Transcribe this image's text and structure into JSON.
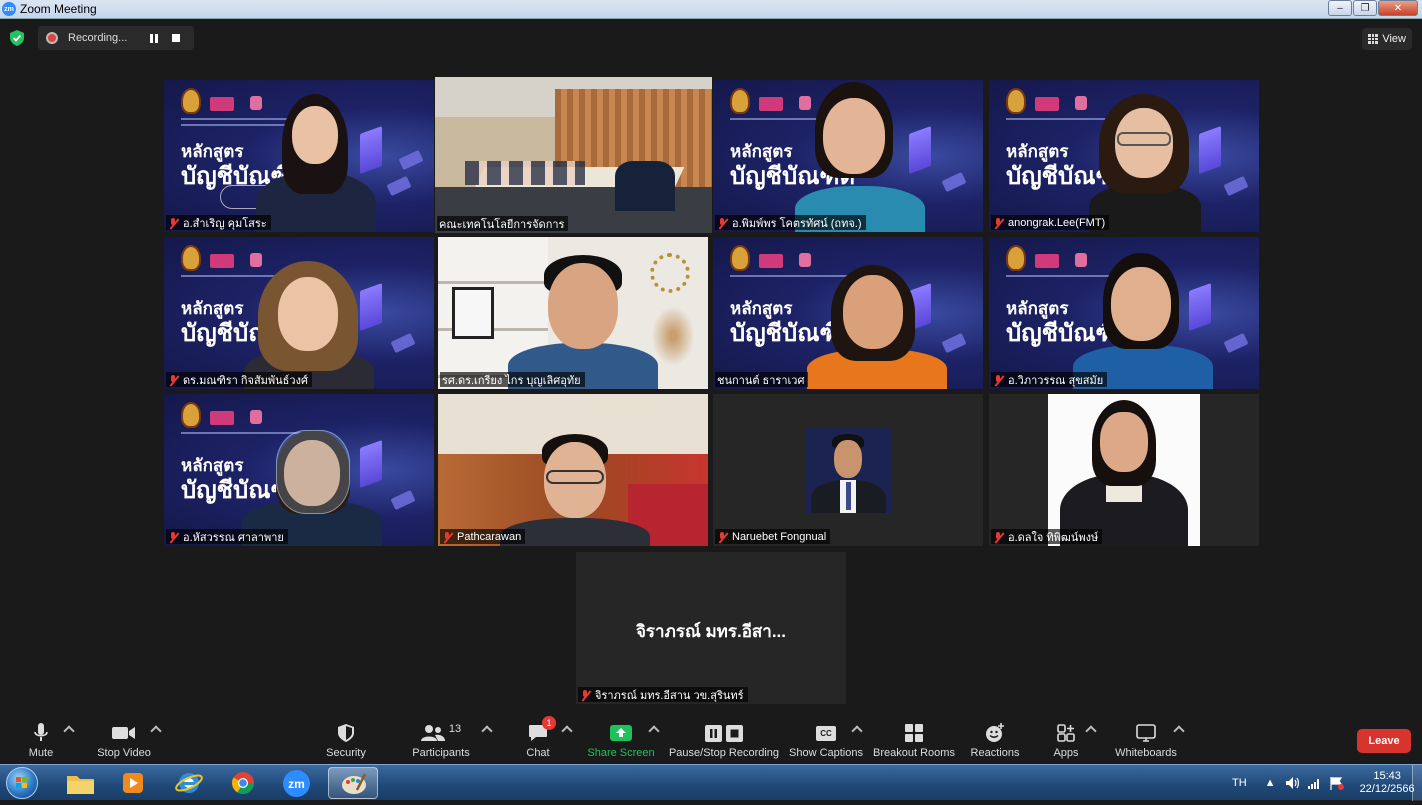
{
  "window": {
    "title": "Zoom Meeting",
    "app_icon": "zm",
    "min": "–",
    "max": "❐",
    "close": "✕"
  },
  "topbar": {
    "recording_label": "Recording...",
    "view_label": "View"
  },
  "participants": [
    {
      "name": "อ.สำเริญ คุมโสระ",
      "muted": true
    },
    {
      "name": "คณะเทคโนโลยีการจัดการ",
      "muted": false
    },
    {
      "name": "อ.พิมพ์พร โคตรทัศน์ (ถทจ.)",
      "muted": true
    },
    {
      "name": "anongrak.Lee(FMT)",
      "muted": true
    },
    {
      "name": "ดร.มณฑิรา กิจสัมพันธ์วงศ์",
      "muted": true
    },
    {
      "name": "รศ.ดร.เกรียง ไกร บุญเลิศอุทัย",
      "muted": false
    },
    {
      "name": "ชนกานต์ ธาราเวศ",
      "muted": false
    },
    {
      "name": "อ.วิภาวรรณ สุขสมัย",
      "muted": true
    },
    {
      "name": "อ.หัสวรรณ ศาลาพาย",
      "muted": true
    },
    {
      "name": "Pathcarawan",
      "muted": true
    },
    {
      "name": "Naruebet Fongnual",
      "muted": true
    },
    {
      "name": "อ.ดลใจ ทิพิฒน์พงษ์",
      "muted": true
    },
    {
      "name": "จิราภรณ์ มทร.อีสาน วข.สุรินทร์",
      "muted": true,
      "display": "จิราภรณ์ มทร.อีสา..."
    }
  ],
  "poster": {
    "line1": "หลักสูตร",
    "line2": "บัญชีบัณฑิต"
  },
  "toolbar": {
    "mute": "Mute",
    "stop_video": "Stop Video",
    "security": "Security",
    "participants": "Participants",
    "participant_count": "13",
    "chat": "Chat",
    "chat_badge": "1",
    "share_screen": "Share Screen",
    "pause_stop_recording": "Pause/Stop Recording",
    "show_captions": "Show Captions",
    "captions_icon": "CC",
    "breakout_rooms": "Breakout Rooms",
    "reactions": "Reactions",
    "apps": "Apps",
    "whiteboards": "Whiteboards",
    "leave": "Leave"
  },
  "taskbar": {
    "language": "TH",
    "time": "15:43",
    "date": "22/12/2566",
    "zoom_app": "zm"
  },
  "colors": {
    "share_green": "#1fc15a",
    "leave_red": "#d7342e",
    "active_speaker": "#e6f36a",
    "zoom_blue": "#2d8cff"
  }
}
